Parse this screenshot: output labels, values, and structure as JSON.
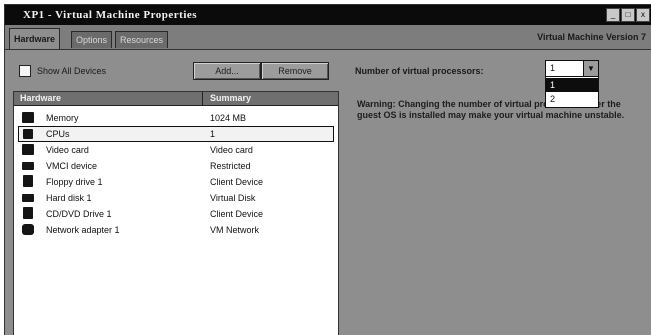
{
  "window": {
    "title": "XP1 - Virtual Machine Properties",
    "controls": [
      "_",
      "□",
      "x"
    ]
  },
  "tabs": [
    {
      "label": "Hardware"
    },
    {
      "label": "Options"
    },
    {
      "label": "Resources"
    }
  ],
  "vm_version": "Virtual Machine Version 7",
  "toolbar": {
    "show_all_devices_label": "Show All Devices",
    "add_label": "Add...",
    "remove_label": "Remove"
  },
  "hardware_table": {
    "headers": [
      "Hardware",
      "Summary"
    ],
    "rows": [
      {
        "name": "Memory",
        "summary": "1024 MB"
      },
      {
        "name": "CPUs",
        "summary": "1"
      },
      {
        "name": "Video card",
        "summary": "Video card"
      },
      {
        "name": "VMCI device",
        "summary": "Restricted"
      },
      {
        "name": "Floppy drive 1",
        "summary": "Client Device"
      },
      {
        "name": "Hard disk 1",
        "summary": "Virtual Disk"
      },
      {
        "name": "CD/DVD Drive 1",
        "summary": "Client Device"
      },
      {
        "name": "Network adapter 1",
        "summary": "VM Network"
      }
    ]
  },
  "cpu_settings": {
    "label": "Number of virtual processors:",
    "selected_value": "1",
    "options": [
      "1",
      "2"
    ],
    "warning": "Warning: Changing the number of virtual processors after the guest OS is installed may make your virtual machine unstable."
  }
}
